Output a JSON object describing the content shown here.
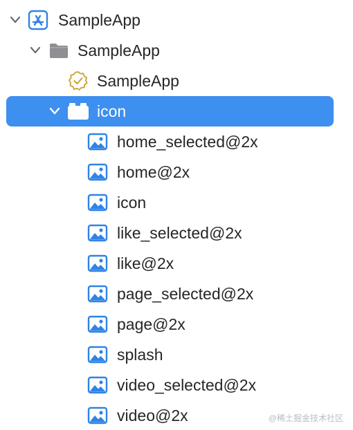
{
  "navigator": {
    "project": {
      "label": "SampleApp",
      "icon": "app-store-icon"
    },
    "group": {
      "label": "SampleApp",
      "icon": "folder-icon"
    },
    "target": {
      "label": "SampleApp",
      "icon": "verified-badge-icon"
    },
    "selected_folder": {
      "label": "icon",
      "icon": "asset-folder-icon",
      "selected": true
    },
    "assets": [
      {
        "label": "home_selected@2x",
        "icon": "image-icon"
      },
      {
        "label": "home@2x",
        "icon": "image-icon"
      },
      {
        "label": "icon",
        "icon": "image-icon"
      },
      {
        "label": "like_selected@2x",
        "icon": "image-icon"
      },
      {
        "label": "like@2x",
        "icon": "image-icon"
      },
      {
        "label": "page_selected@2x",
        "icon": "image-icon"
      },
      {
        "label": "page@2x",
        "icon": "image-icon"
      },
      {
        "label": "splash",
        "icon": "image-icon"
      },
      {
        "label": "video_selected@2x",
        "icon": "image-icon"
      },
      {
        "label": "video@2x",
        "icon": "image-icon"
      }
    ]
  },
  "watermark": {
    "text": "@稀土掘金技术社区"
  },
  "colors": {
    "selection": "#3d8ff0",
    "image_icon": "#2f83e6",
    "folder": "#8e8e93",
    "badge": "#c9a227",
    "text": "#262626"
  }
}
